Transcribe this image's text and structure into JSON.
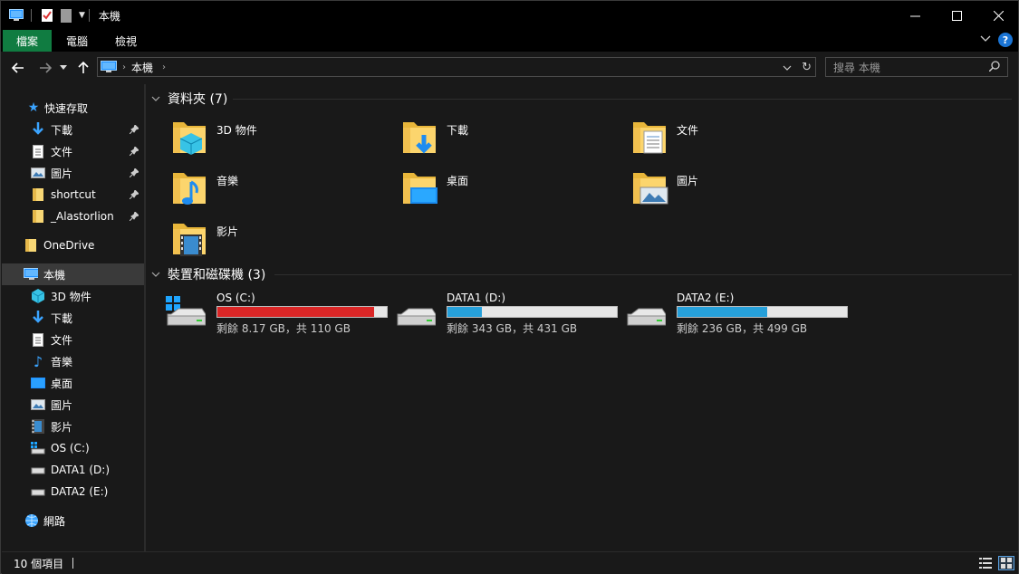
{
  "window": {
    "title": "本機",
    "minimize_icon": "minimize-icon",
    "maximize_icon": "maximize-icon",
    "close_icon": "close-icon"
  },
  "ribbon": {
    "tabs": [
      {
        "label": "檔案",
        "accent": "#107c41"
      },
      {
        "label": "電腦"
      },
      {
        "label": "檢視"
      }
    ]
  },
  "address": {
    "crumbs": [
      "本機"
    ],
    "search_placeholder": "搜尋 本機"
  },
  "sidebar": {
    "quick_access": "快速存取",
    "pinned": [
      {
        "label": "下載",
        "icon": "download-icon"
      },
      {
        "label": "文件",
        "icon": "document-icon"
      },
      {
        "label": "圖片",
        "icon": "picture-icon"
      },
      {
        "label": "shortcut",
        "icon": "folder-icon"
      },
      {
        "label": "_Alastorlion",
        "icon": "folder-icon"
      }
    ],
    "onedrive": "OneDrive",
    "this_pc": "本機",
    "pc_items": [
      {
        "label": "3D 物件",
        "icon": "3d-objects-icon"
      },
      {
        "label": "下載",
        "icon": "download-icon"
      },
      {
        "label": "文件",
        "icon": "document-icon"
      },
      {
        "label": "音樂",
        "icon": "music-icon"
      },
      {
        "label": "桌面",
        "icon": "desktop-icon"
      },
      {
        "label": "圖片",
        "icon": "picture-icon"
      },
      {
        "label": "影片",
        "icon": "video-icon"
      },
      {
        "label": "OS (C:)",
        "icon": "os-drive-icon"
      },
      {
        "label": "DATA1 (D:)",
        "icon": "drive-icon"
      },
      {
        "label": "DATA2 (E:)",
        "icon": "drive-icon"
      }
    ],
    "network": "網路"
  },
  "folders": {
    "header": "資料夾 (7)",
    "items": [
      {
        "label": "3D 物件",
        "icon": "3d-objects-folder-icon"
      },
      {
        "label": "下載",
        "icon": "downloads-folder-icon"
      },
      {
        "label": "文件",
        "icon": "documents-folder-icon"
      },
      {
        "label": "音樂",
        "icon": "music-folder-icon"
      },
      {
        "label": "桌面",
        "icon": "desktop-folder-icon"
      },
      {
        "label": "圖片",
        "icon": "pictures-folder-icon"
      },
      {
        "label": "影片",
        "icon": "videos-folder-icon"
      }
    ]
  },
  "drives": {
    "header": "裝置和磁碟機 (3)",
    "items": [
      {
        "name": "OS (C:)",
        "free": "剩餘 8.17 GB，共 110 GB",
        "used_fraction": 0.926,
        "bar_color": "#da2626"
      },
      {
        "name": "DATA1 (D:)",
        "free": "剩餘 343 GB，共 431 GB",
        "used_fraction": 0.204,
        "bar_color": "#26a0da"
      },
      {
        "name": "DATA2 (E:)",
        "free": "剩餘 236 GB，共 499 GB",
        "used_fraction": 0.527,
        "bar_color": "#26a0da"
      }
    ]
  },
  "status": {
    "count": "10 個項目"
  }
}
